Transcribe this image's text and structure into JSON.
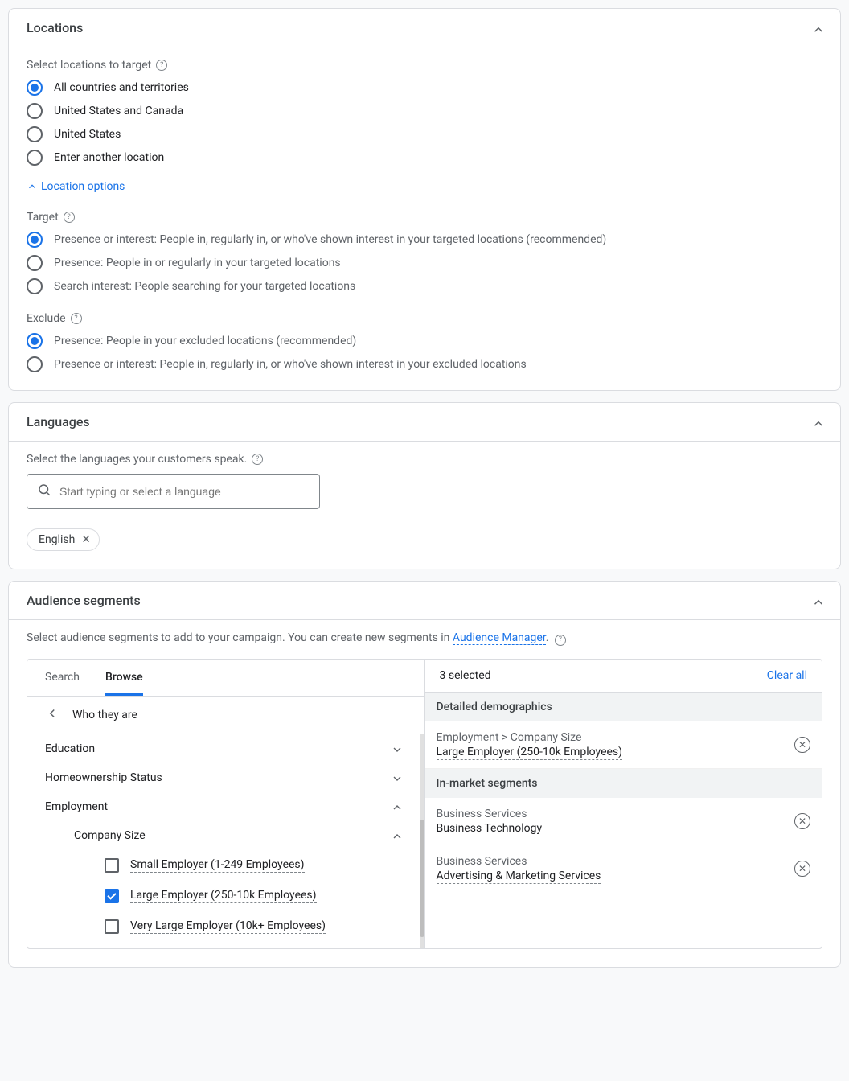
{
  "locations": {
    "title": "Locations",
    "subtitle": "Select locations to target",
    "radios": [
      "All countries and territories",
      "United States and Canada",
      "United States",
      "Enter another location"
    ],
    "options_link": "Location options",
    "target_label": "Target",
    "target_radios": [
      "Presence or interest: People in, regularly in, or who've shown interest in your targeted locations (recommended)",
      "Presence: People in or regularly in your targeted locations",
      "Search interest: People searching for your targeted locations"
    ],
    "exclude_label": "Exclude",
    "exclude_radios": [
      "Presence: People in your excluded locations (recommended)",
      "Presence or interest: People in, regularly in, or who've shown interest in your excluded locations"
    ]
  },
  "languages": {
    "title": "Languages",
    "subtitle": "Select the languages your customers speak.",
    "placeholder": "Start typing or select a language",
    "chip": "English"
  },
  "audience": {
    "title": "Audience segments",
    "intro_pre": "Select audience segments to add to your campaign. You can create new segments in ",
    "intro_link": "Audience Manager",
    "intro_post": ".",
    "tabs": {
      "search": "Search",
      "browse": "Browse"
    },
    "breadcrumb": "Who they are",
    "tree": {
      "education": "Education",
      "homeownership": "Homeownership Status",
      "employment": "Employment",
      "company_size": "Company Size",
      "opt_small": "Small Employer (1-249 Employees)",
      "opt_large": "Large Employer (250-10k Employees)",
      "opt_vlarge": "Very Large Employer (10k+ Employees)"
    },
    "selected_count": "3 selected",
    "clear_all": "Clear all",
    "group1": "Detailed demographics",
    "group2": "In-market segments",
    "selected": [
      {
        "path": "Employment > Company Size",
        "name": "Large Employer (250-10k Employees)"
      },
      {
        "path": "Business Services",
        "name": "Business Technology"
      },
      {
        "path": "Business Services",
        "name": "Advertising & Marketing Services"
      }
    ]
  }
}
